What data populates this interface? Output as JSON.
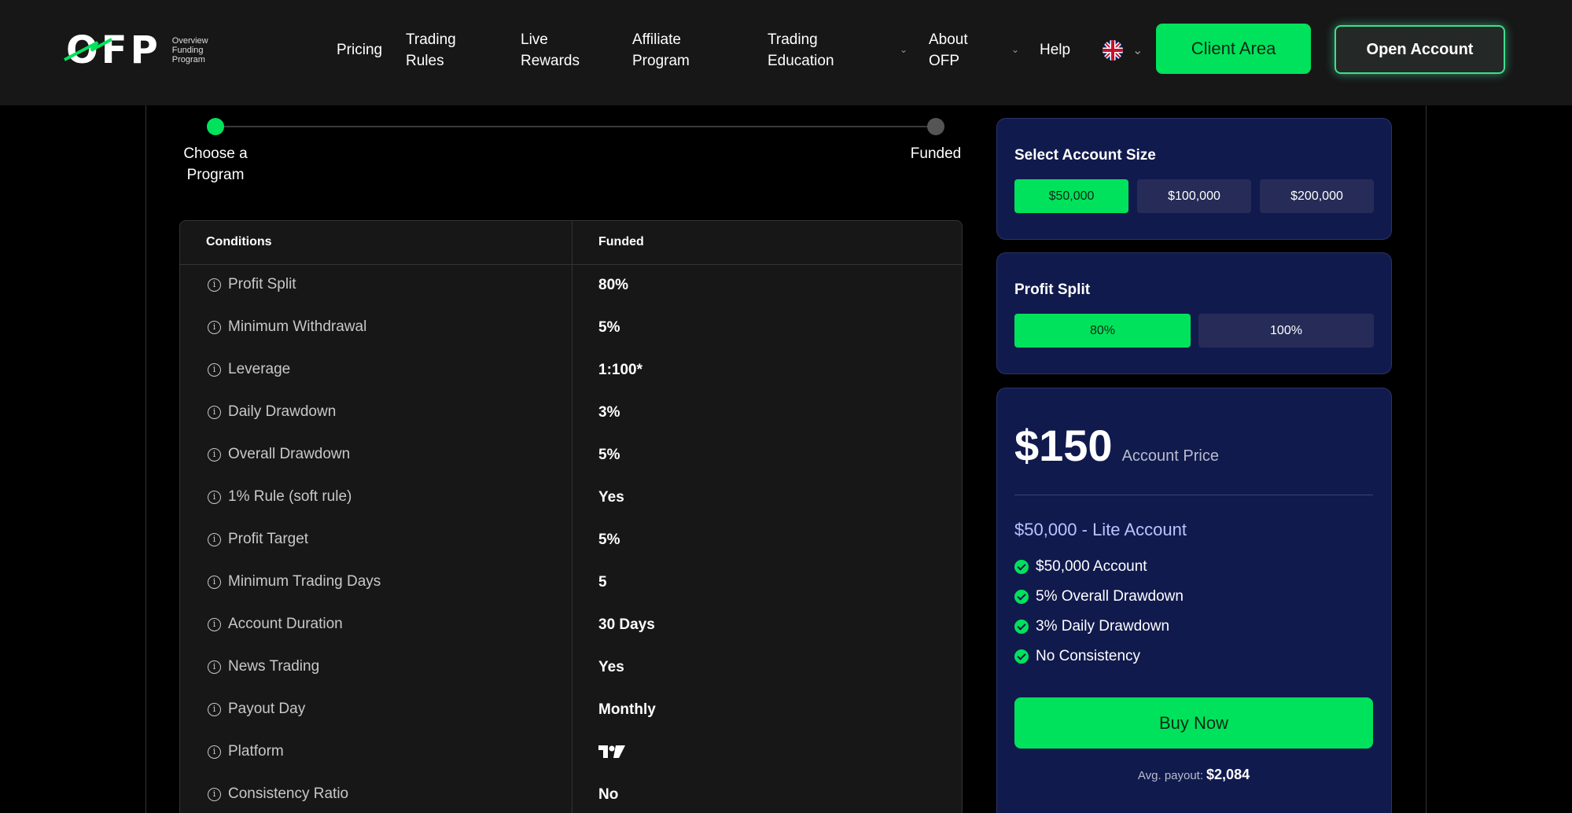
{
  "header": {
    "logo_text": "OFP",
    "logo_sub": [
      "Overview",
      "Funding",
      "Program"
    ],
    "nav": [
      {
        "label": "Pricing"
      },
      {
        "label": "Trading Rules"
      },
      {
        "label": "Live Rewards"
      },
      {
        "label": "Affiliate Program"
      },
      {
        "label": "Trading Education"
      },
      {
        "label": "About OFP"
      },
      {
        "label": "Help"
      }
    ],
    "client_area_label": "Client Area",
    "open_account_label": "Open Account",
    "accent": "#00e25b"
  },
  "progress": {
    "steps": [
      {
        "label": "Choose a Program",
        "active": true
      },
      {
        "label": "Funded",
        "active": false
      }
    ]
  },
  "table": {
    "headers": [
      "Conditions",
      "Funded"
    ],
    "rows": [
      {
        "condition": "Profit Split",
        "value": "80%"
      },
      {
        "condition": "Minimum Withdrawal",
        "value": "5%"
      },
      {
        "condition": "Leverage",
        "value": "1:100*"
      },
      {
        "condition": "Daily Drawdown",
        "value": "3%"
      },
      {
        "condition": "Overall Drawdown",
        "value": "5%"
      },
      {
        "condition": "1% Rule (soft rule)",
        "value": "Yes"
      },
      {
        "condition": "Profit Target",
        "value": "5%"
      },
      {
        "condition": "Minimum Trading Days",
        "value": "5"
      },
      {
        "condition": "Account Duration",
        "value": "30 Days"
      },
      {
        "condition": "News Trading",
        "value": "Yes"
      },
      {
        "condition": "Payout Day",
        "value": "Monthly"
      },
      {
        "condition": "Platform",
        "value": "",
        "icon": "tradingview-logo-icon"
      },
      {
        "condition": "Consistency Ratio",
        "value": "No"
      }
    ]
  },
  "account_size": {
    "title": "Select Account Size",
    "options": [
      "$50,000",
      "$100,000",
      "$200,000"
    ],
    "selected": "$50,000"
  },
  "profit_split": {
    "title": "Profit Split",
    "options": [
      "80%",
      "100%"
    ],
    "selected": "80%"
  },
  "summary": {
    "price": "$150",
    "price_label": "Account Price",
    "account_title": "$50,000 - Lite Account",
    "features": [
      "$50,000 Account",
      "5% Overall Drawdown",
      "3% Daily Drawdown",
      "No Consistency"
    ],
    "buy_label": "Buy Now",
    "avg_payout_label": "Avg. payout:",
    "avg_payout_value": "$2,084"
  }
}
